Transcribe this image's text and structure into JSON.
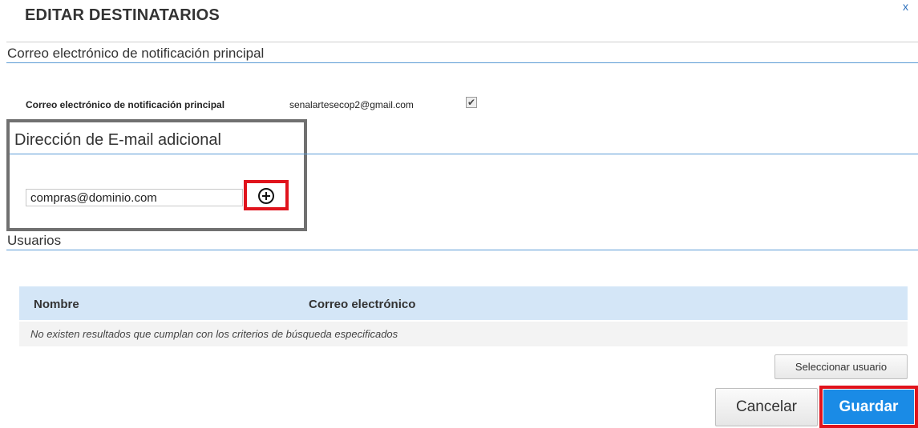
{
  "dialog": {
    "title": "EDITAR DESTINATARIOS",
    "close_label": "x"
  },
  "primary_section": {
    "heading": "Correo electrónico de notificación principal",
    "field_label": "Correo electrónico de notificación principal",
    "email_value": "senalartesecop2@gmail.com",
    "checkbox_checked": true,
    "checkbox_glyph": "✔"
  },
  "additional_section": {
    "heading": "Dirección de E-mail adicional",
    "input_value": "compras@dominio.com",
    "add_icon": "plus-circle-icon"
  },
  "users_section": {
    "heading": "Usuarios",
    "table": {
      "columns": [
        "Nombre",
        "Correo electrónico"
      ],
      "empty_message": "No existen resultados que cumplan con los criterios de búsqueda especificados"
    },
    "select_user_label": "Seleccionar usuario"
  },
  "footer": {
    "cancel_label": "Cancelar",
    "save_label": "Guardar"
  },
  "colors": {
    "accent_blue": "#1a8be6",
    "highlight_red": "#e0131c",
    "table_header_bg": "#d4e6f7",
    "rule_blue": "#5a9bd5"
  }
}
